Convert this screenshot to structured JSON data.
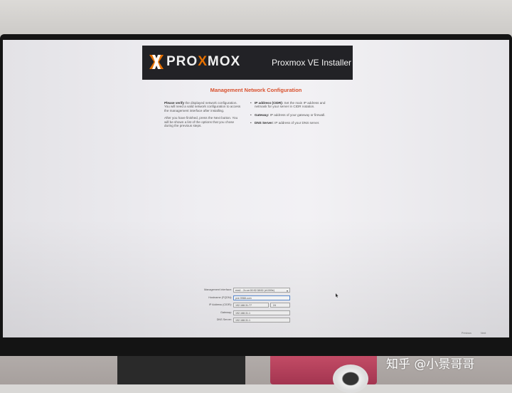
{
  "header": {
    "logo_text_left": "PRO",
    "logo_text_accent": "X",
    "logo_text_right": "MOX",
    "installer_title": "Proxmox VE Installer"
  },
  "page_title": "Management Network Configuration",
  "help": {
    "left": [
      {
        "bold": "Please verify",
        "text": " the displayed network configuration. You will need a valid network configuration to access the management interface after installing."
      },
      {
        "bold": "",
        "text": "After you have finished, press the Next button. You will be shown a list of the options that you chose during the previous steps."
      }
    ],
    "right": [
      {
        "bold": "IP address (CIDR):",
        "text": " Set the main IP address and netmask for your server in CIDR notation."
      },
      {
        "bold": "Gateway:",
        "text": " IP address of your gateway or firewall."
      },
      {
        "bold": "DNS Server:",
        "text": " IP address of your DNS server."
      }
    ]
  },
  "form": {
    "management_interface": {
      "label": "Management Interface:",
      "value": "ens1 - 2c:ce:00:92:38:52 (e1000e)"
    },
    "hostname": {
      "label": "Hostname (FQDN):",
      "value": "pve.9988.com"
    },
    "ip_address": {
      "label": "IP Address (CIDR):",
      "value": "192.168.31.77",
      "cidr": "24"
    },
    "gateway": {
      "label": "Gateway:",
      "value": "192.168.31.1"
    },
    "dns": {
      "label": "DNS Server:",
      "value": "192.168.31.1"
    }
  },
  "footer": {
    "previous_label": "Previous",
    "next_label": "Next"
  },
  "watermark": "知乎 @小景哥哥",
  "colors": {
    "accent": "#e57000",
    "title_red": "#d9512e",
    "header_bg": "#222226"
  }
}
